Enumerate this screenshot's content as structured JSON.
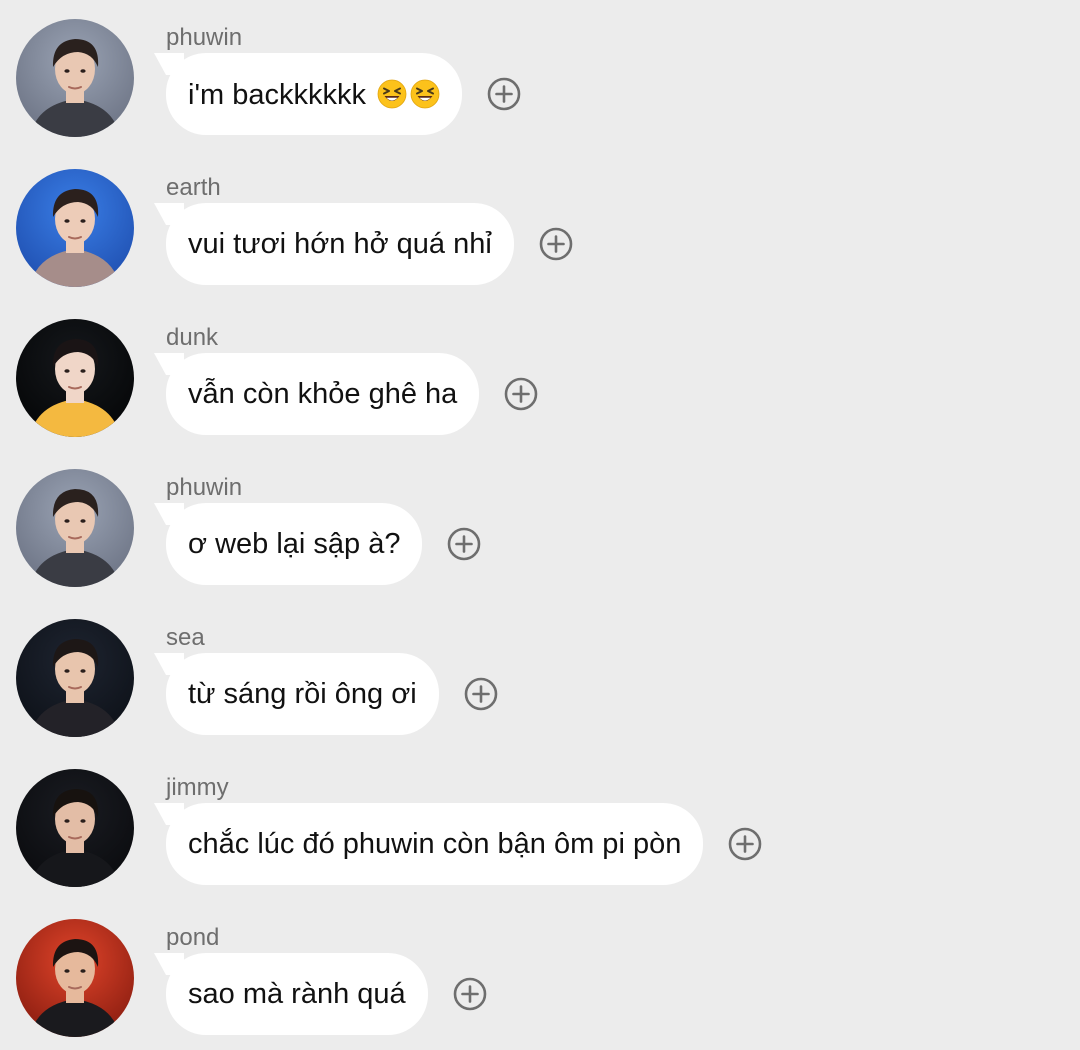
{
  "messages": [
    {
      "sender": "phuwin",
      "text": "i'm backkkkkk",
      "emoji": [
        "grinning-squinting-face",
        "grinning-squinting-face"
      ],
      "avatar": "phuwin"
    },
    {
      "sender": "earth",
      "text": "vui tươi hớn hở quá nhỉ",
      "emoji": [],
      "avatar": "earth"
    },
    {
      "sender": "dunk",
      "text": "vẫn còn khỏe ghê ha",
      "emoji": [],
      "avatar": "dunk"
    },
    {
      "sender": "phuwin",
      "text": "ơ web lại sập à?",
      "emoji": [],
      "avatar": "phuwin"
    },
    {
      "sender": "sea",
      "text": "từ sáng rồi ông ơi",
      "emoji": [],
      "avatar": "sea"
    },
    {
      "sender": "jimmy",
      "text": "chắc lúc đó phuwin còn bận ôm pi pòn",
      "emoji": [],
      "avatar": "jimmy"
    },
    {
      "sender": "pond",
      "text": "sao mà rành quá",
      "emoji": [],
      "avatar": "pond"
    }
  ],
  "colors": {
    "background": "#ececec",
    "bubble": "#ffffff",
    "sender_text": "#6e6e6e",
    "message_text": "#111111",
    "react_icon": "#6e6e6e"
  },
  "icons": {
    "react_button": "add-reaction-icon",
    "emoji": "grinning-squinting-face"
  }
}
